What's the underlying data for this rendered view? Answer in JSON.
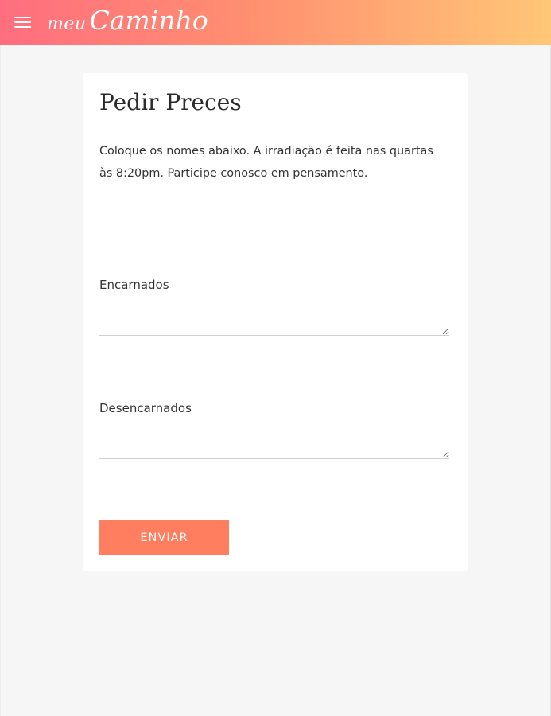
{
  "appbar": {
    "menu_icon": "menu-icon",
    "brand_prefix": "meu",
    "brand_name": "Caminho",
    "gradient": [
      "#ff6e7f",
      "#ff8f70",
      "#ffc777"
    ]
  },
  "form": {
    "title": "Pedir Preces",
    "description": "Coloque os nomes abaixo. A irradiação é feita nas quartas às 8:20pm. Participe conosco em pensamento.",
    "fields": [
      {
        "label": "Encarnados",
        "value": ""
      },
      {
        "label": "Desencarnados",
        "value": ""
      }
    ],
    "submit_label": "ENVIAR",
    "submit_color": "#ff7e5f"
  }
}
